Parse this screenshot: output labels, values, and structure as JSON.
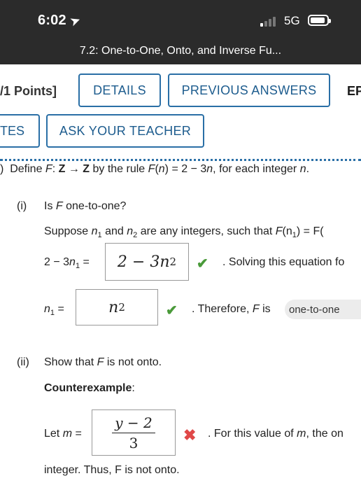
{
  "status_bar": {
    "time": "6:02",
    "location_icon": "location-arrow-icon",
    "network": "5G",
    "signal_icon": "cellular-signal-icon",
    "battery_icon": "battery-icon"
  },
  "header": {
    "title": "7.2: One-to-One, Onto, and Inverse Fu..."
  },
  "toolbar": {
    "points_label": "/1 Points]",
    "details_label": "DETAILS",
    "previous_answers_label": "PREVIOUS ANSWERS",
    "ep_cut_label": "EP",
    "notes_cut_label": "TES",
    "ask_teacher_label": "ASK YOUR TEACHER"
  },
  "problem": {
    "marker": ")",
    "statement_prefix": "Define ",
    "F": "F",
    "colon": ": ",
    "Z1": "Z",
    "arrow": " → ",
    "Z2": "Z",
    "rule_prefix": " by the rule ",
    "F2": "F",
    "rule_expr_open": "(",
    "n": "n",
    "rule_expr_close": ") = 2 − 3",
    "n2": "n",
    "statement_suffix": ", for each integer ",
    "n3": "n",
    "period": "."
  },
  "part_i": {
    "label": "(i)",
    "question_prefix": "Is ",
    "question_F": "F",
    "question_suffix": " one-to-one?",
    "suppose_text": "Suppose",
    "n1": "n",
    "sub1": "1",
    "and_text": "and",
    "n2": "n",
    "sub2": "2",
    "integers_text": "are any integers, such that",
    "F_of_n1": "F",
    "paren_n1": "(n",
    "sub_paren": "1",
    "equals_cut": ") = F(",
    "eq_lhs": "2 − 3",
    "eq_n": "n",
    "eq_sub": "1",
    "eq_equals": "=",
    "answer1_base": "2 − 3n",
    "answer1_sub": "2",
    "after_answer1": ". Solving this equation fo",
    "n1_lhs": "n",
    "n1_lhs_sub": "1",
    "n1_equals": "=",
    "answer2_base": "n",
    "answer2_sub": "2",
    "therefore_prefix": ". Therefore, ",
    "therefore_F": "F",
    "therefore_is": " is",
    "select_value": "one-to-one"
  },
  "part_ii": {
    "label": "(ii)",
    "question_prefix": "Show that ",
    "question_F": "F",
    "question_suffix": " is not onto.",
    "counterexample_label": "Counterexample",
    "counterexample_colon": ":",
    "let_text": "Let ",
    "let_m": "m",
    "let_equals": " =",
    "answer3_numerator": "y − 2",
    "answer3_denominator": "3",
    "after_answer3_prefix": ". For this value of ",
    "after_answer3_m": "m",
    "after_answer3_suffix": ", the on",
    "conclusion": "integer. Thus, F is not onto."
  },
  "colors": {
    "header_bg": "#2b2b2b",
    "accent_blue": "#2a6fa6",
    "correct_green": "#4a9a3a",
    "wrong_red": "#e04848"
  }
}
